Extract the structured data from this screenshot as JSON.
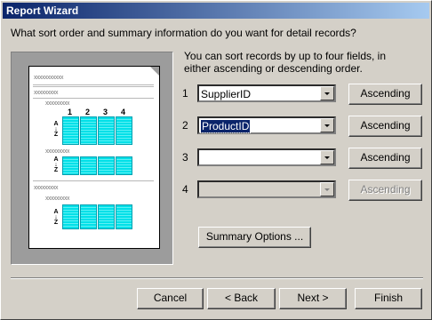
{
  "window": {
    "title": "Report Wizard"
  },
  "prompt": "What sort order and summary information do you want for detail records?",
  "preview": {
    "placeholder_short": "xxxxxxxxxxx",
    "placeholder_long": "xxxxxxxxx",
    "placeholder_group": "xxxxxxxxx",
    "column_numbers": [
      "1",
      "2",
      "3",
      "4"
    ],
    "sort_glyph": "A↓Z"
  },
  "instructions": "You can sort records by up to four fields, in either ascending or descending order.",
  "sort_rows": [
    {
      "number": "1",
      "field": "SupplierID",
      "order": "Ascending",
      "enabled": true
    },
    {
      "number": "2",
      "field": "ProductID",
      "order": "Ascending",
      "enabled": true
    },
    {
      "number": "3",
      "field": "",
      "order": "Ascending",
      "enabled": true
    },
    {
      "number": "4",
      "field": "",
      "order": "Ascending",
      "enabled": false
    }
  ],
  "summary_button": "Summary Options ...",
  "buttons": {
    "cancel": "Cancel",
    "back": "< Back",
    "next": "Next >",
    "finish": "Finish"
  }
}
